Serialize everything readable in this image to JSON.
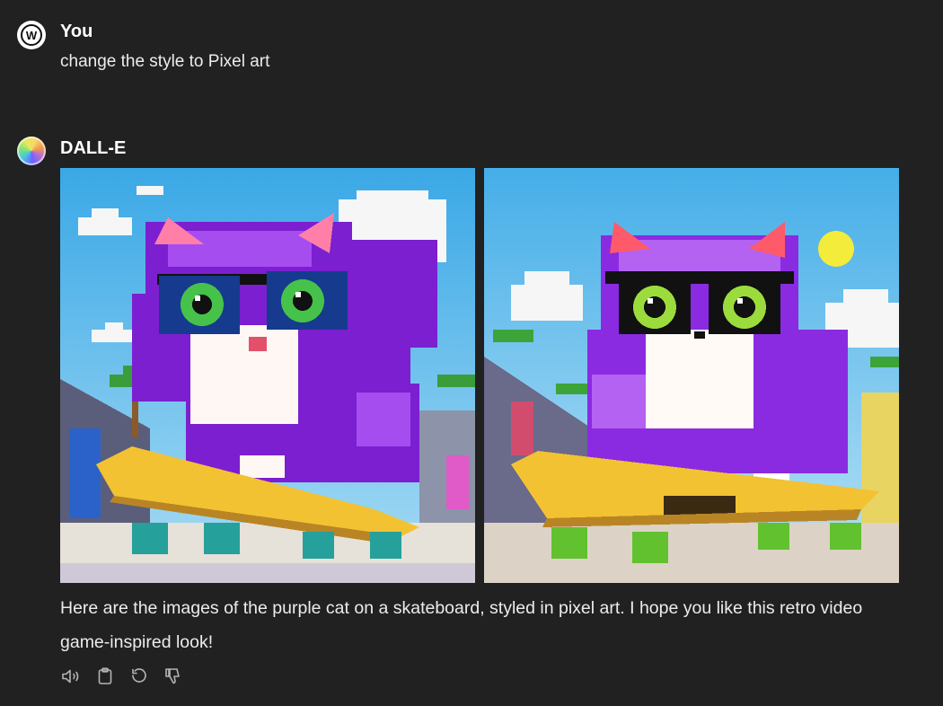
{
  "user": {
    "avatar_letter": "W",
    "name": "You",
    "message": "change the style to Pixel art"
  },
  "assistant": {
    "name": "DALL-E",
    "images": [
      {
        "icon": "pixel-cat-image-1"
      },
      {
        "icon": "pixel-cat-image-2"
      }
    ],
    "reply": "Here are the images of the purple cat on a skateboard, styled in pixel art. I hope you like this retro video game-inspired look!",
    "actions": [
      {
        "icon": "speaker-icon"
      },
      {
        "icon": "clipboard-icon"
      },
      {
        "icon": "regenerate-icon"
      },
      {
        "icon": "thumbs-down-icon"
      }
    ]
  },
  "colors": {
    "background": "#212121",
    "text": "#ececec",
    "sky": "#4fb3e8",
    "cat_purple": "#8a2be2"
  }
}
